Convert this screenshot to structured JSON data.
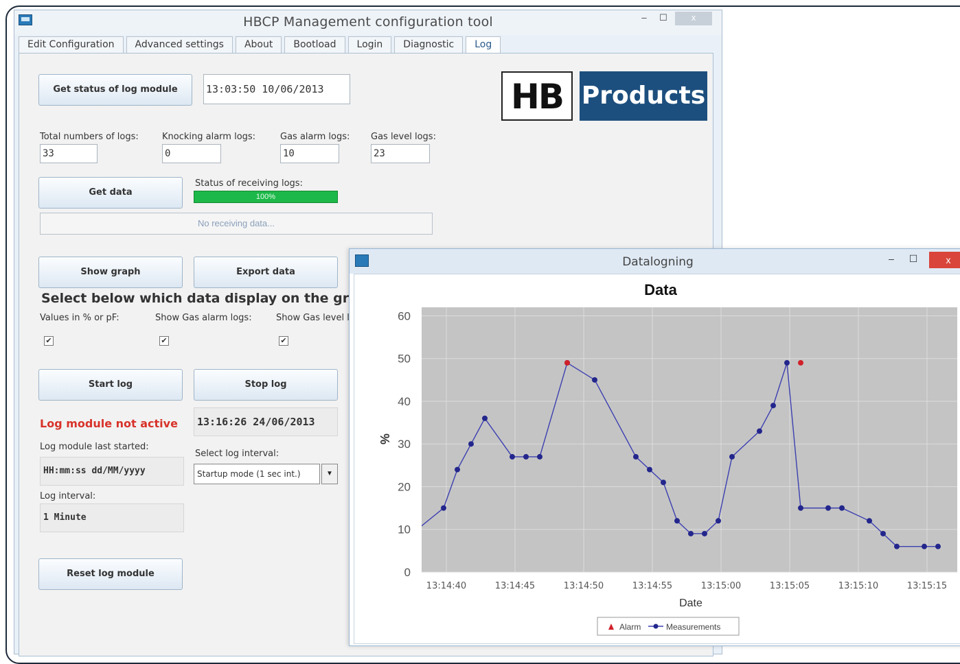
{
  "main_window": {
    "title": "HBCP Management configuration tool",
    "minimize": "–",
    "maximize": "☐",
    "close": "x"
  },
  "tabs": [
    "Edit Configuration",
    "Advanced settings",
    "About",
    "Bootload",
    "Login",
    "Diagnostic",
    "Log"
  ],
  "active_tab": "Log",
  "log_panel": {
    "get_status_button": "Get status of log module",
    "status_time": "13:03:50 10/06/2013",
    "total_logs_label": "Total numbers of logs:",
    "total_logs_value": "33",
    "knocking_label": "Knocking alarm logs:",
    "knocking_value": "0",
    "gas_alarm_label": "Gas alarm logs:",
    "gas_alarm_value": "10",
    "gas_level_label": "Gas level logs:",
    "gas_level_value": "23",
    "get_data_button": "Get data",
    "receiving_status_label": "Status of receiving logs:",
    "progress_text": "100%",
    "progress_value": 1.0,
    "receiving_message": "No receiving data...",
    "show_graph_button": "Show graph",
    "export_data_button": "Export data",
    "select_heading": "Select below which data display on the graph",
    "values_label": "Values in % or pF:",
    "show_gas_alarm_label": "Show Gas alarm logs:",
    "show_gas_level_label": "Show Gas level l",
    "checkmark": "✔",
    "start_log_button": "Start log",
    "stop_log_button": "Stop log",
    "module_status": "Log module not active",
    "module_time": "13:16:26 24/06/2013",
    "last_started_label": "Log module last started:",
    "last_started_value": "HH:mm:ss dd/MM/yyyy",
    "select_interval_label": "Select log interval:",
    "interval_selected": "Startup mode (1 sec int.)",
    "dropdown_arrow": "▼",
    "log_interval_label": "Log interval:",
    "log_interval_value": "1 Minute",
    "reset_button": "Reset log module"
  },
  "logo": {
    "left": "HB",
    "right": "Products"
  },
  "datalogging_window": {
    "title": "Datalogning",
    "minimize": "–",
    "maximize": "☐",
    "close": "x"
  },
  "chart_data": {
    "type": "line",
    "title": "Data",
    "xlabel": "Date",
    "ylabel": "%",
    "ylim": [
      0,
      62
    ],
    "y_ticks": [
      0,
      10,
      20,
      30,
      40,
      50,
      60
    ],
    "x_ticks": [
      "13:14:40",
      "13:14:45",
      "13:14:50",
      "13:14:55",
      "13:15:00",
      "13:15:05",
      "13:15:10",
      "13:15:15"
    ],
    "x_tick_seconds": [
      40,
      45,
      50,
      55,
      60,
      65,
      70,
      75
    ],
    "xlim_seconds": [
      38.2,
      77.2
    ],
    "grid": true,
    "legend_position": "bottom",
    "series": [
      {
        "name": "Measurements",
        "color": "#3c3fb0",
        "x": [
          37.5,
          39.8,
          40.8,
          41.8,
          42.8,
          44.8,
          45.8,
          46.8,
          48.8,
          50.8,
          53.8,
          54.8,
          55.8,
          56.8,
          57.8,
          58.8,
          59.8,
          60.8,
          62.8,
          63.8,
          64.8,
          65.8,
          67.8,
          68.8,
          70.8,
          71.8,
          72.8,
          74.8,
          75.8
        ],
        "y": [
          9,
          15,
          24,
          30,
          36,
          27,
          27,
          27,
          49,
          45,
          27,
          24,
          21,
          12,
          9,
          9,
          12,
          27,
          33,
          39,
          49,
          15,
          15,
          15,
          12,
          9,
          6,
          6,
          6
        ]
      },
      {
        "name": "Alarm",
        "color": "#d0202a",
        "marker": "triangle",
        "x": [
          48.8,
          65.8
        ],
        "y": [
          49,
          49
        ]
      }
    ]
  }
}
